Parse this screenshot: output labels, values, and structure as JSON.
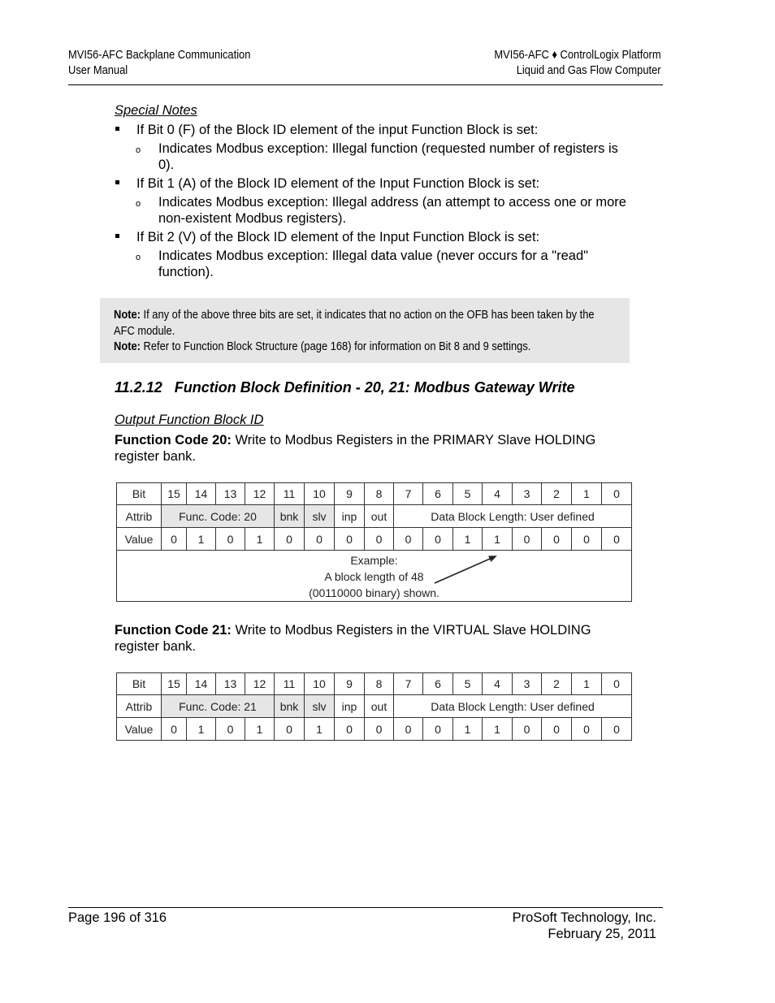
{
  "header": {
    "left_line1": "MVI56-AFC Backplane Communication",
    "left_line2": "User Manual",
    "right_line1": "MVI56-AFC ♦ ControlLogix Platform",
    "right_line2": "Liquid and Gas Flow Computer"
  },
  "special_notes": {
    "title": "Special Notes",
    "items": [
      {
        "text": "If Bit 0 (F) of the Block ID element of the input Function Block is set:",
        "sub": "Indicates Modbus exception: Illegal function (requested number of registers is 0)."
      },
      {
        "text": "If Bit 1 (A) of the Block ID element of the Input Function Block is set:",
        "sub": "Indicates Modbus exception: Illegal address (an attempt to access one or more non-existent Modbus registers)."
      },
      {
        "text": "If Bit 2 (V) of the Block ID element of the Input Function Block is set:",
        "sub": "Indicates Modbus exception: Illegal data value (never occurs for a \"read\" function)."
      }
    ]
  },
  "notes": [
    {
      "label": "Note:",
      "text": " If any of the above three bits are set, it indicates that no action on the OFB has been taken by the AFC module."
    },
    {
      "label": "Note:",
      "text": " Refer to Function Block Structure (page 168) for information on Bit 8 and 9 settings."
    }
  ],
  "section": {
    "number": "11.2.12",
    "title": "Function Block Definition - 20, 21: Modbus Gateway Write"
  },
  "output_block_title": "Output Function Block ID",
  "fc20": {
    "label": "Function Code 20:",
    "desc": " Write to Modbus Registers in the PRIMARY Slave HOLDING register bank.",
    "table": {
      "row_labels": [
        "Bit",
        "Attrib",
        "Value"
      ],
      "bits": [
        "15",
        "14",
        "13",
        "12",
        "11",
        "10",
        "9",
        "8",
        "7",
        "6",
        "5",
        "4",
        "3",
        "2",
        "1",
        "0"
      ],
      "attrib": {
        "func_code": "Func. Code: 20",
        "bnk": "bnk",
        "slv": "slv",
        "inp": "inp",
        "out": "out",
        "data_len": "Data Block Length: User defined"
      },
      "values": [
        "0",
        "1",
        "0",
        "1",
        "0",
        "0",
        "0",
        "0",
        "0",
        "0",
        "1",
        "1",
        "0",
        "0",
        "0",
        "0"
      ],
      "example": [
        "Example:",
        "A block length of 48",
        "(00110000 binary) shown."
      ]
    }
  },
  "fc21": {
    "label": "Function Code 21:",
    "desc": " Write to Modbus Registers in the VIRTUAL Slave HOLDING register bank.",
    "table": {
      "row_labels": [
        "Bit",
        "Attrib",
        "Value"
      ],
      "bits": [
        "15",
        "14",
        "13",
        "12",
        "11",
        "10",
        "9",
        "8",
        "7",
        "6",
        "5",
        "4",
        "3",
        "2",
        "1",
        "0"
      ],
      "attrib": {
        "func_code": "Func. Code: 21",
        "bnk": "bnk",
        "slv": "slv",
        "inp": "inp",
        "out": "out",
        "data_len": "Data Block Length: User defined"
      },
      "values": [
        "0",
        "1",
        "0",
        "1",
        "0",
        "1",
        "0",
        "0",
        "0",
        "0",
        "1",
        "1",
        "0",
        "0",
        "0",
        "0"
      ]
    }
  },
  "footer": {
    "page": "Page 196 of 316",
    "company": "ProSoft Technology, Inc.",
    "date": "February 25, 2011"
  },
  "colors": {
    "note_bg": "#e6e6e6",
    "shade_cell": "#e6e6e6"
  }
}
